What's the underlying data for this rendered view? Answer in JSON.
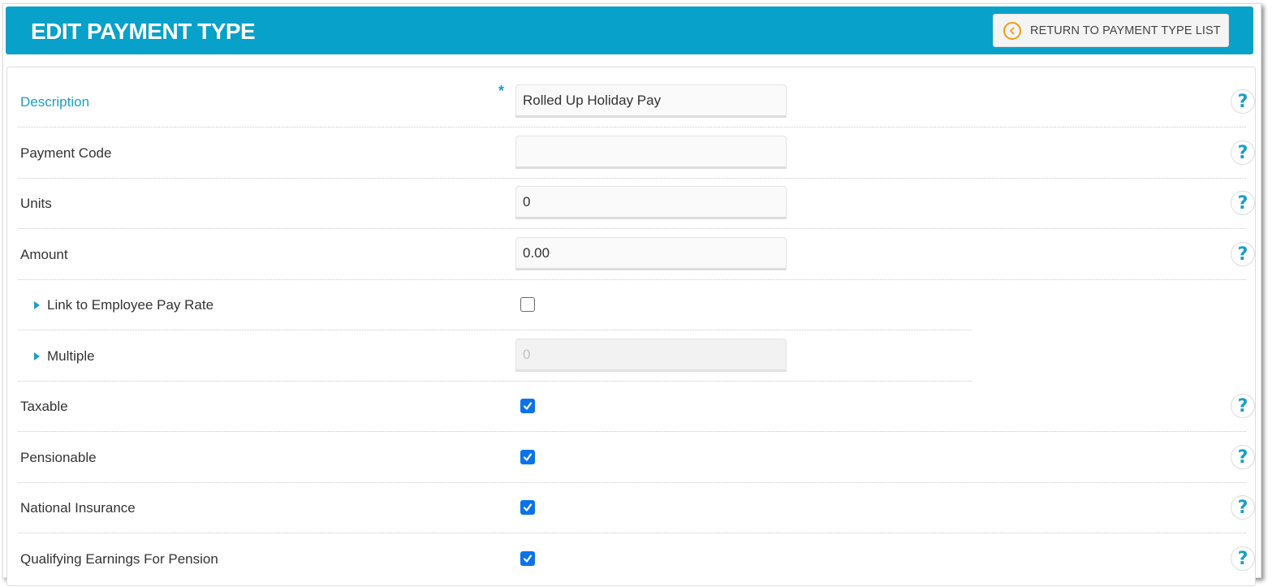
{
  "header": {
    "title": "EDIT PAYMENT TYPE",
    "return_button_label": "RETURN TO PAYMENT TYPE LIST",
    "return_icon": "chevron-left-circle-icon"
  },
  "colors": {
    "header_bg": "#08a1c9",
    "accent": "#1a9fc8",
    "return_icon": "#f39c12",
    "checkbox_checked": "#0b73ea"
  },
  "form": {
    "rows": [
      {
        "label": "Description",
        "required": true,
        "required_marker": "*",
        "type": "text",
        "value": "Rolled Up Holiday Pay",
        "help": true
      },
      {
        "label": "Payment Code",
        "required": false,
        "type": "text",
        "value": "",
        "help": true
      },
      {
        "label": "Units",
        "required": false,
        "type": "text",
        "value": "0",
        "help": true
      },
      {
        "label": "Amount",
        "required": false,
        "type": "text",
        "value": "0.00",
        "help": true
      },
      {
        "label": "Link to Employee Pay Rate",
        "sub": true,
        "type": "checkbox",
        "checked": false,
        "help": false
      },
      {
        "label": "Multiple",
        "sub": true,
        "type": "text",
        "value": "0",
        "disabled": true,
        "help": false
      },
      {
        "label": "Taxable",
        "type": "checkbox",
        "checked": true,
        "help": true
      },
      {
        "label": "Pensionable",
        "type": "checkbox",
        "checked": true,
        "help": true
      },
      {
        "label": "National Insurance",
        "type": "checkbox",
        "checked": true,
        "help": true
      },
      {
        "label": "Qualifying Earnings For Pension",
        "type": "checkbox",
        "checked": true,
        "help": true
      }
    ],
    "help_glyph": "?"
  }
}
